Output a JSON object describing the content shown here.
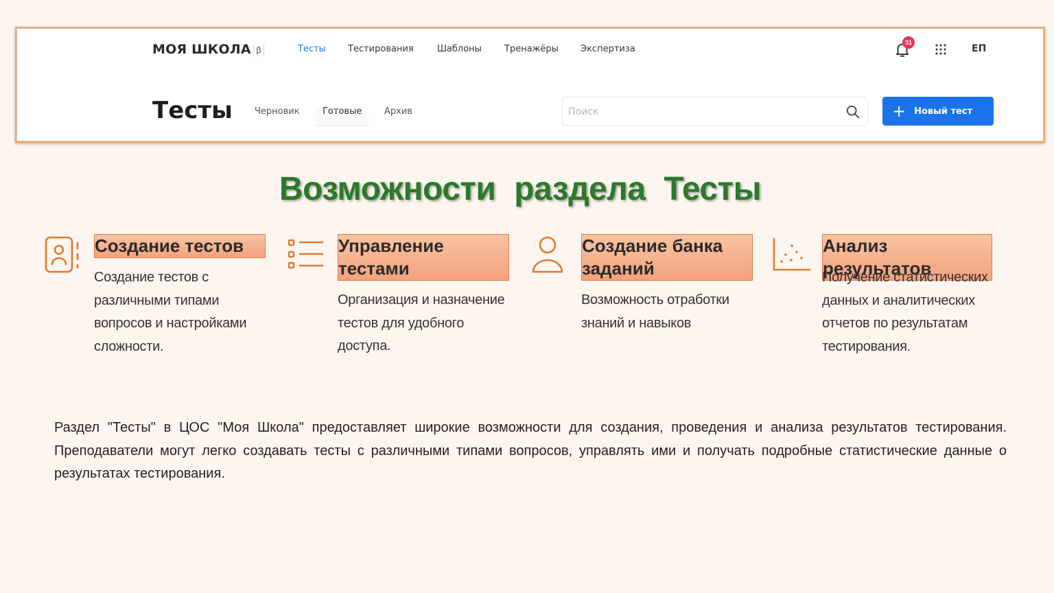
{
  "app": {
    "logo": "МОЯ ШКОЛА",
    "beta": "β",
    "nav": [
      {
        "label": "Тесты",
        "active": true
      },
      {
        "label": "Тестирования",
        "active": false
      },
      {
        "label": "Шаблоны",
        "active": false
      },
      {
        "label": "Тренажёры",
        "active": false
      },
      {
        "label": "Экспертиза",
        "active": false
      }
    ],
    "notifications_count": "31",
    "user_initials": "ЕП",
    "page_title": "Тесты",
    "subtabs": [
      {
        "label": "Черновик",
        "selected": false
      },
      {
        "label": "Готовые",
        "selected": true
      },
      {
        "label": "Архив",
        "selected": false
      }
    ],
    "search_placeholder": "Поиск",
    "new_button_label": "Новый тест",
    "accent_color": "#1a73e8",
    "badge_color": "#e8335a"
  },
  "slide": {
    "title": "Возможности раздела Тесты",
    "title_color": "#2a7a2a",
    "icon_color": "#e07a2c",
    "features": [
      {
        "icon": "contact-book-icon",
        "heading": "Создание   тестов",
        "text": "Создание тестов с различными типами вопросов и настройками сложности."
      },
      {
        "icon": "list-icon",
        "heading": "Управление тестами",
        "text": "Организация и назначение тестов для удобного доступа."
      },
      {
        "icon": "user-icon",
        "heading": "Создание  банка заданий",
        "text": "Возможность отработки знаний и навыков"
      },
      {
        "icon": "scatter-chart-icon",
        "heading": "Анализ  результатов",
        "text": "Получение статистических данных и аналитических отчетов по результатам тестирования."
      }
    ],
    "paragraph": "Раздел \"Тесты\" в ЦОС \"Моя Школа\" предоставляет широкие возможности для создания, проведения и анализа результатов тестирования. Преподаватели могут легко создавать тесты с различными типами вопросов, управлять ими и получать подробные статистические данные о результатах тестирования."
  }
}
